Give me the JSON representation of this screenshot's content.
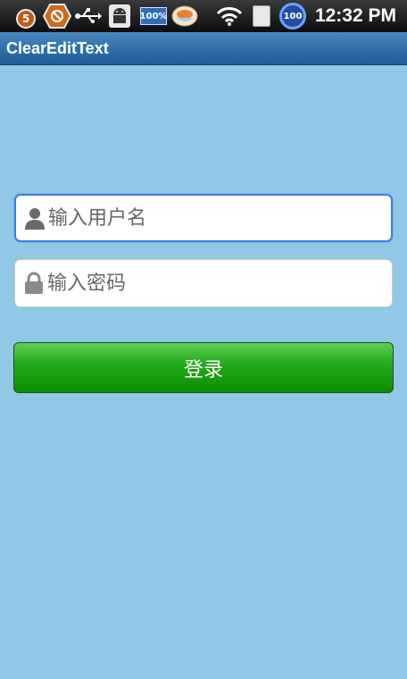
{
  "status_bar": {
    "notification_count": "5",
    "battery_app_label": "100%",
    "circle_badge_label": "100",
    "time": "12:32 PM",
    "icons": [
      "badge-five-icon",
      "settings-hex-icon",
      "usb-icon",
      "android-icon",
      "battery-percent-icon",
      "food-bowl-icon",
      "wifi-icon",
      "sim-card-icon",
      "circle-100-icon"
    ]
  },
  "title_bar": {
    "title": "ClearEditText"
  },
  "form": {
    "username_placeholder": "输入用户名",
    "password_placeholder": "输入密码",
    "login_label": "登录"
  },
  "colors": {
    "background": "#90c8e6",
    "title_bar": "#2d6aa8",
    "login_button": "#23a81a",
    "focused_border": "#3b7fd9"
  }
}
